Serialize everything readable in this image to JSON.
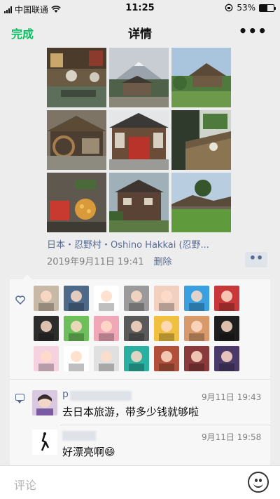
{
  "status": {
    "carrier": "中国联通",
    "time": "11:25",
    "battery": "53%",
    "battery_level": 0.53
  },
  "nav": {
    "done_label": "完成",
    "title": "详情",
    "more_label": "•••"
  },
  "photos": [
    {
      "name": "photo-1",
      "desc": "shrine-with-signs"
    },
    {
      "name": "photo-2",
      "desc": "mount-fuji-village"
    },
    {
      "name": "photo-3",
      "desc": "thatched-house-garden"
    },
    {
      "name": "photo-4",
      "desc": "waterwheel-hut"
    },
    {
      "name": "photo-5",
      "desc": "traditional-shop"
    },
    {
      "name": "photo-6",
      "desc": "thatched-roof-cat"
    },
    {
      "name": "photo-7",
      "desc": "food-stall"
    },
    {
      "name": "photo-8",
      "desc": "old-wooden-house"
    },
    {
      "name": "photo-9",
      "desc": "green-field-houses"
    }
  ],
  "post": {
    "location": "日本・忍野村・Oshino Hakkai (忍野...",
    "timestamp": "2019年9月11日 19:41",
    "delete_label": "删除",
    "more_dots": "••"
  },
  "likes": {
    "count": 21
  },
  "comments": [
    {
      "name": "p",
      "time": "9月11日 19:43",
      "text": "去日本旅游，带多少钱就够啦"
    },
    {
      "name": "",
      "time": "9月11日 19:58",
      "text": "好漂亮啊😄"
    }
  ],
  "input": {
    "placeholder": "评论"
  },
  "colors": {
    "accent_green": "#07c160",
    "link_blue": "#576b95"
  }
}
